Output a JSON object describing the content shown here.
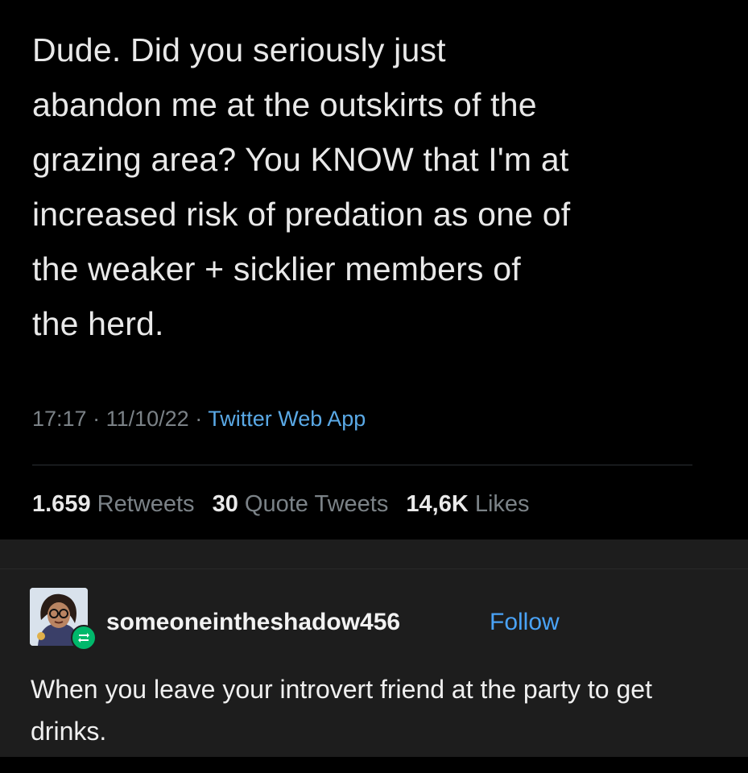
{
  "tweet": {
    "text": "Dude. Did you seriously just\nabandon me at the outskirts of the\ngrazing area? You KNOW that I'm at\nincreased risk of predation as one of\nthe weaker + sicklier members of\nthe herd.",
    "time": "17:17",
    "date": "11/10/22",
    "source": "Twitter Web App",
    "retweets_count": "1.659",
    "retweets_label": "Retweets",
    "quotes_count": "30",
    "quotes_label": "Quote Tweets",
    "likes_count": "14,6K",
    "likes_label": "Likes"
  },
  "post": {
    "username": "someoneintheshadow456",
    "follow_label": "Follow",
    "body": "When you leave your introvert friend at the party to get drinks.",
    "avatar_icon": "avatar-illustration",
    "badge_icon": "reblog-icon",
    "badge_color": "#00b86b"
  }
}
